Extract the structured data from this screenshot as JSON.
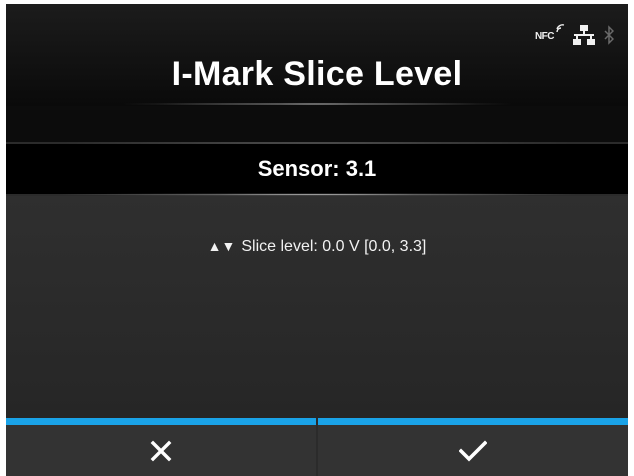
{
  "header": {
    "title": "I-Mark Slice Level",
    "status": {
      "nfc_label": "NFC",
      "icons": [
        "nfc-icon",
        "network-icon",
        "bluetooth-icon"
      ]
    }
  },
  "sensor": {
    "label": "Sensor: 3.1"
  },
  "slice": {
    "arrows": "▲▼",
    "text": "Slice level: 0.0 V [0.0, 3.3]"
  },
  "footer": {
    "cancel_icon": "close-icon",
    "confirm_icon": "checkmark-icon"
  },
  "colors": {
    "accent": "#1aa3e8",
    "background": "#2b2b2b",
    "header": "#0a0a0a",
    "text": "#ffffff"
  }
}
